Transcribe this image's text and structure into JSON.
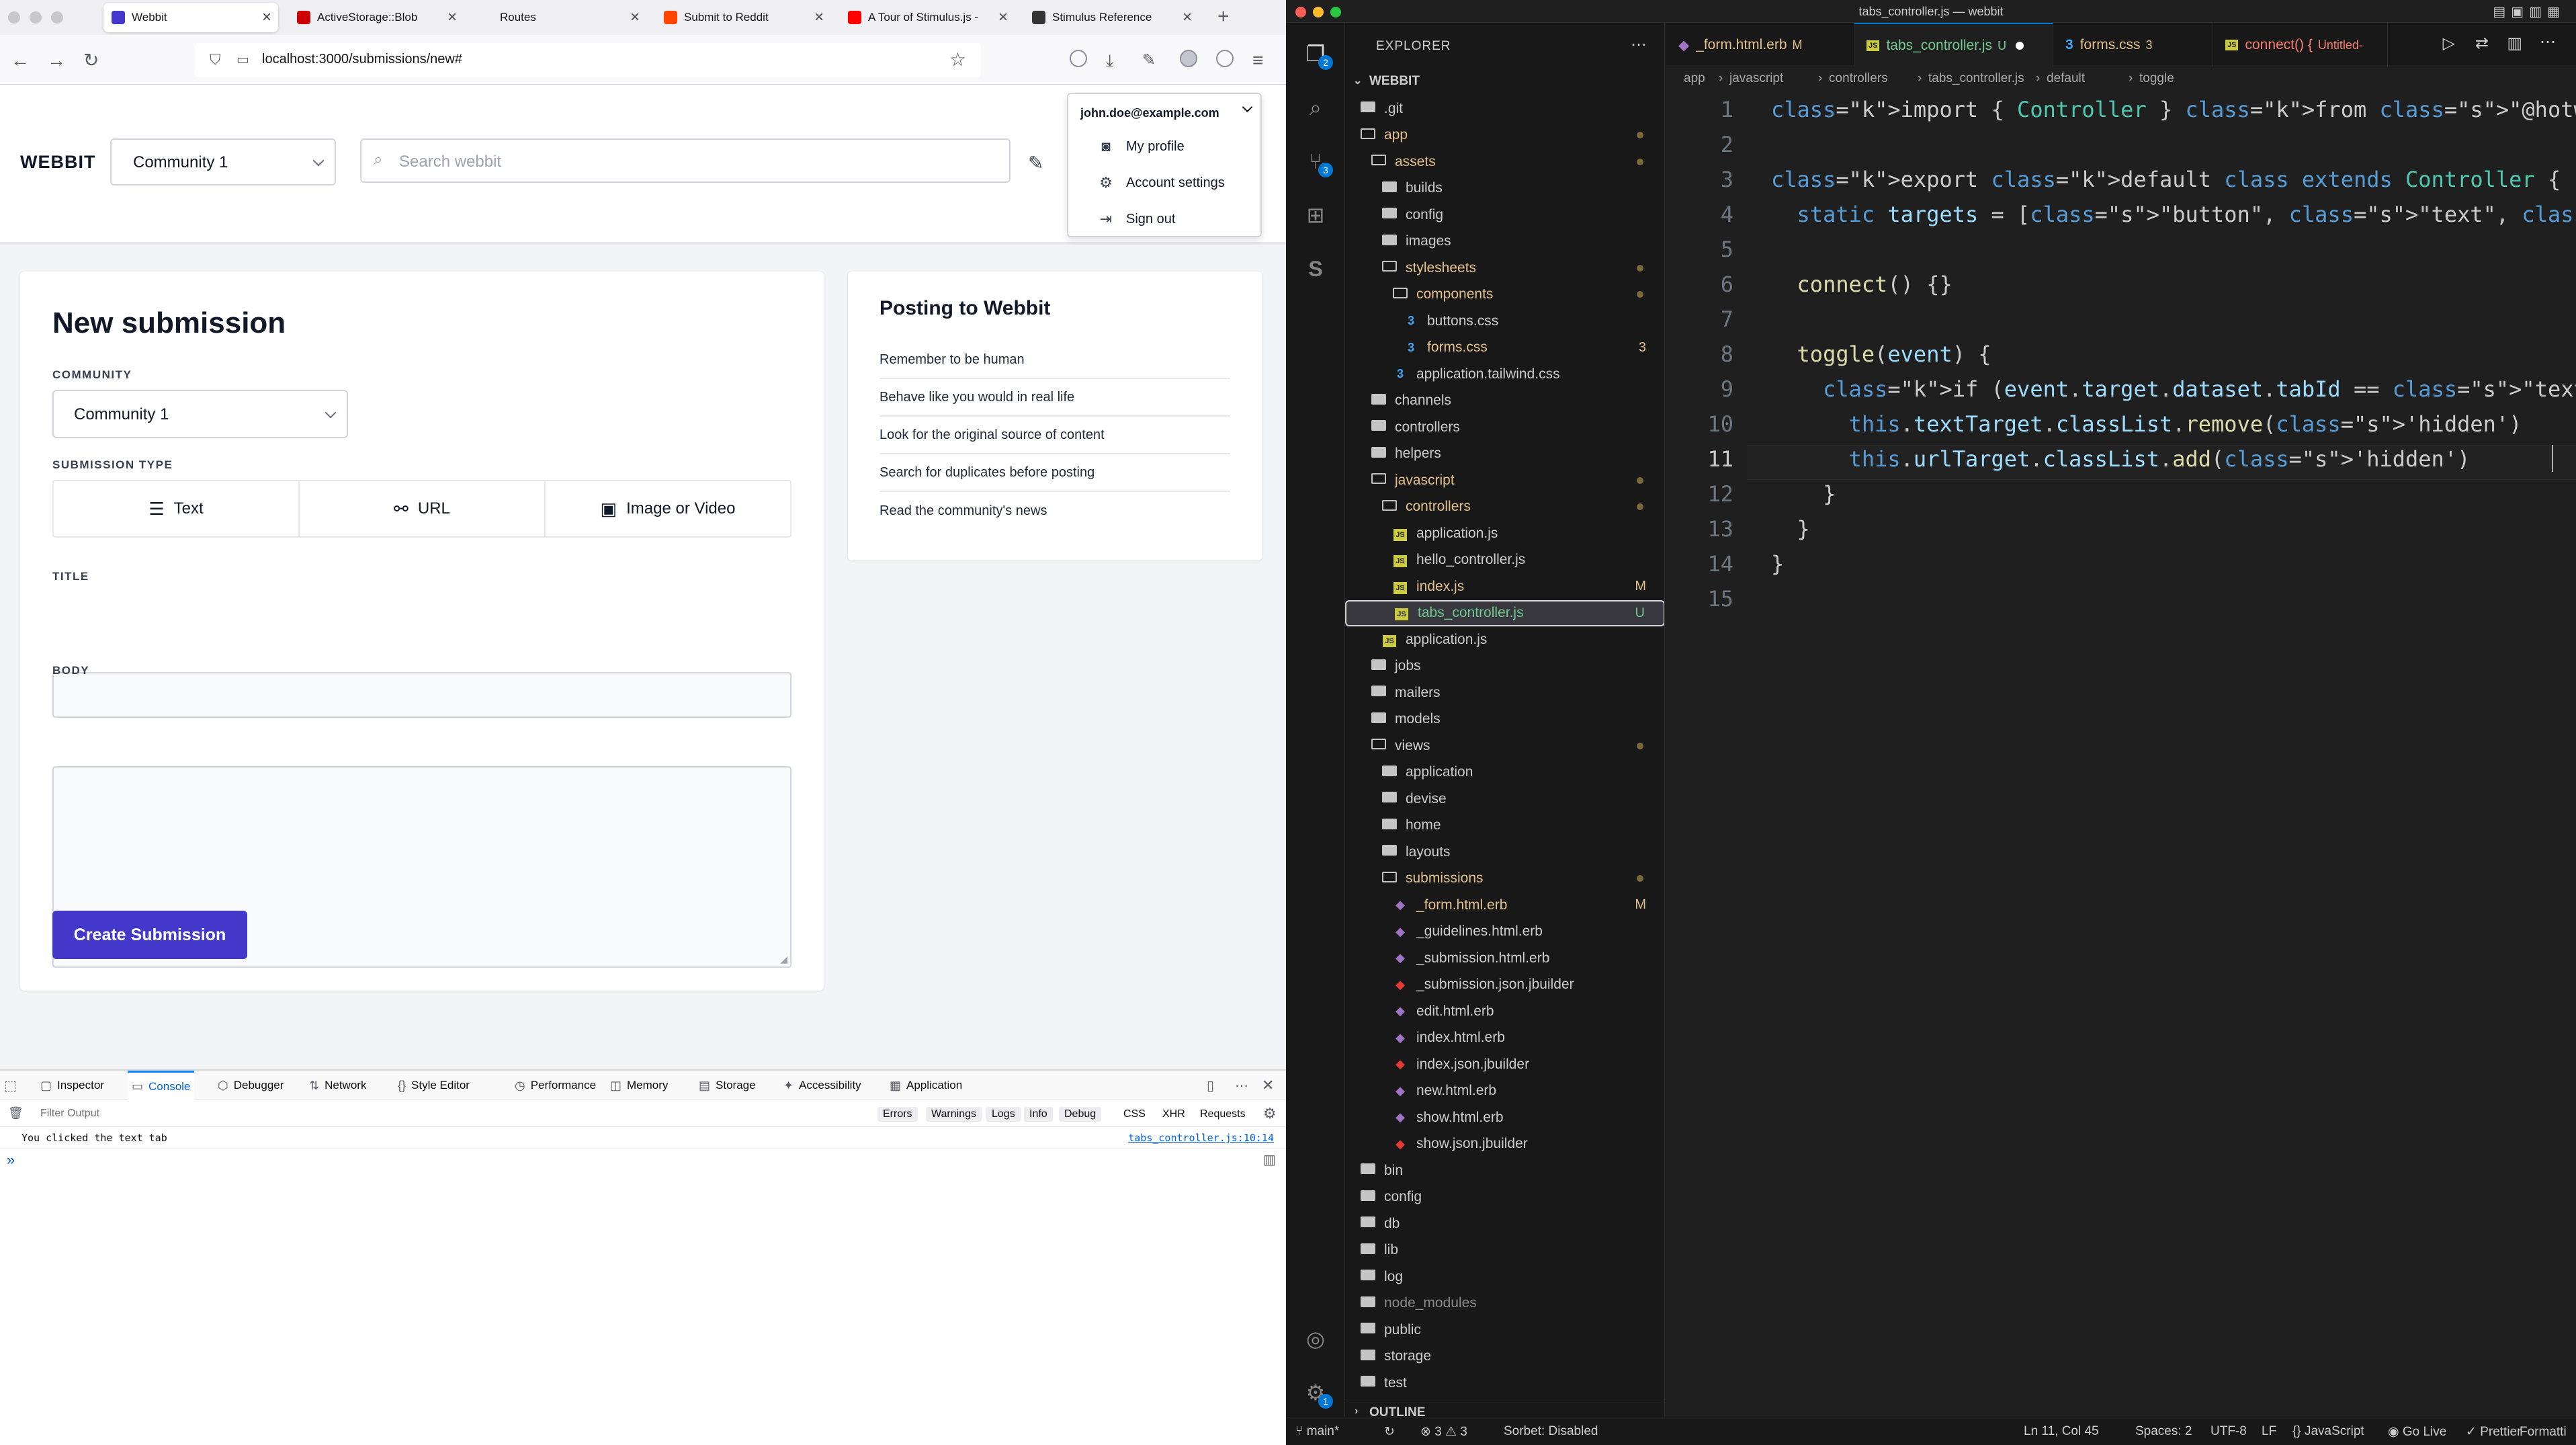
{
  "browser": {
    "tabs": [
      {
        "title": "Webbit",
        "active": true,
        "fav_color": "#4338ca"
      },
      {
        "title": "ActiveStorage::Blob",
        "active": false,
        "fav_color": "#cc0000"
      },
      {
        "title": "Routes",
        "active": false,
        "fav_color": "#f0f0f4"
      },
      {
        "title": "Submit to Reddit",
        "active": false,
        "fav_color": "#ff4500"
      },
      {
        "title": "A Tour of Stimulus.js -",
        "active": false,
        "fav_color": "#ff0000"
      },
      {
        "title": "Stimulus Reference",
        "active": false,
        "fav_color": "#333333"
      }
    ],
    "url": "localhost:3000/submissions/new#"
  },
  "webbit": {
    "logo": "WEBBIT",
    "community_select": "Community 1",
    "search_placeholder": "Search webbit",
    "user_menu": {
      "email": "john.doe@example.com",
      "items": [
        "My profile",
        "Account settings",
        "Sign out"
      ]
    },
    "form": {
      "title": "New submission",
      "community_label": "COMMUNITY",
      "community_value": "Community 1",
      "type_label": "SUBMISSION TYPE",
      "types": [
        "Text",
        "URL",
        "Image or Video"
      ],
      "title_label": "TITLE",
      "title_value": "",
      "body_label": "BODY",
      "body_value": "",
      "submit": "Create Submission"
    },
    "guidelines": {
      "title": "Posting to Webbit",
      "items": [
        "Remember to be human",
        "Behave like you would in real life",
        "Look for the original source of content",
        "Search for duplicates before posting",
        "Read the community's news"
      ]
    }
  },
  "devtools": {
    "tabs": [
      "Inspector",
      "Console",
      "Debugger",
      "Network",
      "Style Editor",
      "Performance",
      "Memory",
      "Storage",
      "Accessibility",
      "Application"
    ],
    "active_tab": "Console",
    "filter_placeholder": "Filter Output",
    "filters": [
      "Errors",
      "Warnings",
      "Logs",
      "Info",
      "Debug",
      "CSS",
      "XHR",
      "Requests"
    ],
    "log_message": "You clicked the text tab",
    "log_source": "tabs_controller.js:10:14"
  },
  "vscode": {
    "window_title": "tabs_controller.js — webbit",
    "explorer_title": "EXPLORER",
    "workspace": "WEBBIT",
    "badges": {
      "explorer": "2",
      "scm": "3",
      "settings": "1"
    },
    "tree": [
      {
        "name": ".git",
        "indent": 0,
        "type": "folder",
        "color": "#cccccc"
      },
      {
        "name": "app",
        "indent": 0,
        "type": "folder-open",
        "color": "#e2c08d",
        "dot": true
      },
      {
        "name": "assets",
        "indent": 1,
        "type": "folder-open",
        "color": "#e2c08d",
        "dot": true
      },
      {
        "name": "builds",
        "indent": 2,
        "type": "folder",
        "color": "#cccccc"
      },
      {
        "name": "config",
        "indent": 2,
        "type": "folder",
        "color": "#cccccc"
      },
      {
        "name": "images",
        "indent": 2,
        "type": "folder",
        "color": "#cccccc"
      },
      {
        "name": "stylesheets",
        "indent": 2,
        "type": "folder-open",
        "color": "#e2c08d",
        "dot": true
      },
      {
        "name": "components",
        "indent": 3,
        "type": "folder-open",
        "color": "#e2c08d",
        "dot": true
      },
      {
        "name": "buttons.css",
        "indent": 4,
        "type": "css",
        "color": "#cccccc"
      },
      {
        "name": "forms.css",
        "indent": 4,
        "type": "css",
        "color": "#e2c08d",
        "stat": "3"
      },
      {
        "name": "application.tailwind.css",
        "indent": 3,
        "type": "css",
        "color": "#cccccc"
      },
      {
        "name": "channels",
        "indent": 1,
        "type": "folder",
        "color": "#cccccc"
      },
      {
        "name": "controllers",
        "indent": 1,
        "type": "folder",
        "color": "#cccccc"
      },
      {
        "name": "helpers",
        "indent": 1,
        "type": "folder",
        "color": "#cccccc"
      },
      {
        "name": "javascript",
        "indent": 1,
        "type": "folder-open",
        "color": "#e2c08d",
        "dot": true
      },
      {
        "name": "controllers",
        "indent": 2,
        "type": "folder-open",
        "color": "#e2c08d",
        "dot": true
      },
      {
        "name": "application.js",
        "indent": 3,
        "type": "js",
        "color": "#cccccc"
      },
      {
        "name": "hello_controller.js",
        "indent": 3,
        "type": "js",
        "color": "#cccccc"
      },
      {
        "name": "index.js",
        "indent": 3,
        "type": "js",
        "color": "#e2c08d",
        "stat": "M"
      },
      {
        "name": "tabs_controller.js",
        "indent": 3,
        "type": "js",
        "color": "#73c991",
        "stat": "U",
        "selected": true
      },
      {
        "name": "application.js",
        "indent": 2,
        "type": "js",
        "color": "#cccccc"
      },
      {
        "name": "jobs",
        "indent": 1,
        "type": "folder",
        "color": "#cccccc"
      },
      {
        "name": "mailers",
        "indent": 1,
        "type": "folder",
        "color": "#cccccc"
      },
      {
        "name": "models",
        "indent": 1,
        "type": "folder",
        "color": "#cccccc"
      },
      {
        "name": "views",
        "indent": 1,
        "type": "folder-open",
        "color": "#cccccc",
        "dot": true
      },
      {
        "name": "application",
        "indent": 2,
        "type": "folder",
        "color": "#cccccc"
      },
      {
        "name": "devise",
        "indent": 2,
        "type": "folder",
        "color": "#cccccc"
      },
      {
        "name": "home",
        "indent": 2,
        "type": "folder",
        "color": "#cccccc"
      },
      {
        "name": "layouts",
        "indent": 2,
        "type": "folder",
        "color": "#cccccc"
      },
      {
        "name": "submissions",
        "indent": 2,
        "type": "folder-open",
        "color": "#e2c08d",
        "dot": true
      },
      {
        "name": "_form.html.erb",
        "indent": 3,
        "type": "erb",
        "color": "#e2c08d",
        "stat": "M"
      },
      {
        "name": "_guidelines.html.erb",
        "indent": 3,
        "type": "erb",
        "color": "#cccccc"
      },
      {
        "name": "_submission.html.erb",
        "indent": 3,
        "type": "erb",
        "color": "#cccccc"
      },
      {
        "name": "_submission.json.jbuilder",
        "indent": 3,
        "type": "rb",
        "color": "#cccccc"
      },
      {
        "name": "edit.html.erb",
        "indent": 3,
        "type": "erb",
        "color": "#cccccc"
      },
      {
        "name": "index.html.erb",
        "indent": 3,
        "type": "erb",
        "color": "#cccccc"
      },
      {
        "name": "index.json.jbuilder",
        "indent": 3,
        "type": "rb",
        "color": "#cccccc"
      },
      {
        "name": "new.html.erb",
        "indent": 3,
        "type": "erb",
        "color": "#cccccc"
      },
      {
        "name": "show.html.erb",
        "indent": 3,
        "type": "erb",
        "color": "#cccccc"
      },
      {
        "name": "show.json.jbuilder",
        "indent": 3,
        "type": "rb",
        "color": "#cccccc"
      },
      {
        "name": "bin",
        "indent": 0,
        "type": "folder",
        "color": "#cccccc"
      },
      {
        "name": "config",
        "indent": 0,
        "type": "folder",
        "color": "#cccccc"
      },
      {
        "name": "db",
        "indent": 0,
        "type": "folder",
        "color": "#cccccc"
      },
      {
        "name": "lib",
        "indent": 0,
        "type": "folder",
        "color": "#cccccc"
      },
      {
        "name": "log",
        "indent": 0,
        "type": "folder",
        "color": "#cccccc"
      },
      {
        "name": "node_modules",
        "indent": 0,
        "type": "folder",
        "color": "#8b8b8b"
      },
      {
        "name": "public",
        "indent": 0,
        "type": "folder",
        "color": "#cccccc"
      },
      {
        "name": "storage",
        "indent": 0,
        "type": "folder",
        "color": "#cccccc"
      },
      {
        "name": "test",
        "indent": 0,
        "type": "folder",
        "color": "#cccccc"
      }
    ],
    "outline": "OUTLINE",
    "editor_tabs": [
      {
        "name": "_form.html.erb",
        "stat": "M",
        "active": false,
        "color": "#e2c08d",
        "icon": "erb"
      },
      {
        "name": "tabs_controller.js",
        "stat": "U",
        "active": true,
        "color": "#73c991",
        "icon": "js",
        "dirty": true
      },
      {
        "name": "forms.css",
        "stat": "3",
        "active": false,
        "color": "#e2c08d",
        "icon": "css"
      },
      {
        "name": "connect() {",
        "stat": "Untitled-",
        "active": false,
        "color": "#f88070",
        "icon": "js"
      }
    ],
    "breadcrumbs": [
      "app",
      "javascript",
      "controllers",
      "tabs_controller.js",
      "default",
      "toggle"
    ],
    "code_lines": [
      "import { Controller } from \"@hotwired/stimulus\"",
      "",
      "export default class extends Controller {",
      "  static targets = [\"button\", \"text\", \"url\", \"media\"]",
      "",
      "  connect() {}",
      "",
      "  toggle(event) {",
      "    if (event.target.dataset.tabId == \"text\") {",
      "      this.textTarget.classList.remove('hidden')",
      "      this.urlTarget.classList.add('hidden')",
      "    }",
      "  }",
      "}",
      ""
    ],
    "current_line": 11,
    "status": {
      "branch": "main*",
      "errors": "3",
      "warnings": "3",
      "sorbet": "Sorbet: Disabled",
      "position": "Ln 11, Col 45",
      "spaces": "Spaces: 2",
      "encoding": "UTF-8",
      "eol": "LF",
      "language": "JavaScript",
      "golive": "Go Live",
      "prettier": "Prettier",
      "formatting": "Formatting: ✓"
    }
  }
}
